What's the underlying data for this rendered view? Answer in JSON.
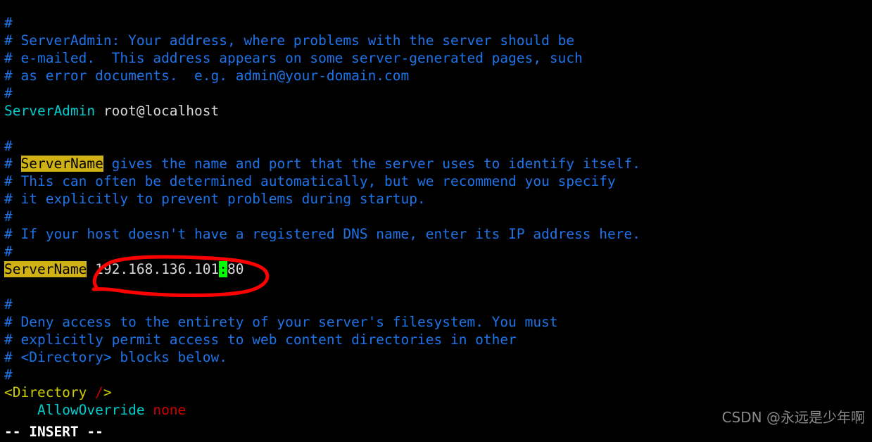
{
  "terminal": {
    "background_color": "#000000",
    "comment_color": "#1e73e8",
    "directive_color": "#00cdcd",
    "value_color": "#d8d8d8",
    "tag_color": "#cdcd00",
    "slash_color": "#cd0000",
    "search_highlight_bg": "#d1b215",
    "search_highlight_fg": "#000000",
    "cursor_color": "#00ff00",
    "annotation_color": "#ff0000"
  },
  "lines": [
    {
      "id": 1,
      "hash": "#",
      "text": ""
    },
    {
      "id": 2,
      "hash": "#",
      "text": " ServerAdmin: Your address, where problems with the server should be"
    },
    {
      "id": 3,
      "hash": "#",
      "text": " e-mailed.  This address appears on some server-generated pages, such"
    },
    {
      "id": 4,
      "hash": "#",
      "text": " as error documents.  e.g. admin@your-domain.com"
    },
    {
      "id": 5,
      "hash": "#",
      "text": ""
    },
    {
      "id": 6,
      "directive": "ServerAdmin",
      "value": " root@localhost"
    },
    {
      "id": 7,
      "text": ""
    },
    {
      "id": 8,
      "hash": "#",
      "text": ""
    },
    {
      "id": 9,
      "hash": "#",
      "pre": " ",
      "highlight": "ServerName",
      "post": " gives the name and port that the server uses to identify itself."
    },
    {
      "id": 10,
      "hash": "#",
      "text": " This can often be determined automatically, but we recommend you specify"
    },
    {
      "id": 11,
      "hash": "#",
      "text": " it explicitly to prevent problems during startup."
    },
    {
      "id": 12,
      "hash": "#",
      "text": ""
    },
    {
      "id": 13,
      "hash": "#",
      "text": " If your host doesn't have a registered DNS name, enter its IP address here."
    },
    {
      "id": 14,
      "hash": "#",
      "text": ""
    },
    {
      "id": 15,
      "highlight": "ServerName",
      "value_before": " 192.168.136.101",
      "cursor_char": ":",
      "value_after": "80"
    },
    {
      "id": 16,
      "text": ""
    },
    {
      "id": 17,
      "hash": "#",
      "text": ""
    },
    {
      "id": 18,
      "hash": "#",
      "text": " Deny access to the entirety of your server's filesystem. You must"
    },
    {
      "id": 19,
      "hash": "#",
      "text": " explicitly permit access to web content directories in other"
    },
    {
      "id": 20,
      "hash": "#",
      "text": " <Directory> blocks below."
    },
    {
      "id": 21,
      "hash": "#",
      "text": ""
    },
    {
      "id": 22,
      "tag_open": "<Directory ",
      "slash": "/",
      "tag_close": ">"
    },
    {
      "id": 23,
      "indent": "    ",
      "directive": "AllowOverride",
      "keyword": " none"
    }
  ],
  "status": {
    "mode_label": "-- INSERT --"
  },
  "annotation": {
    "shape": "hand-drawn-red-ellipse",
    "encircles": "ServerName 192.168.136.101:80"
  },
  "watermark": {
    "text": "CSDN @永远是少年啊"
  }
}
